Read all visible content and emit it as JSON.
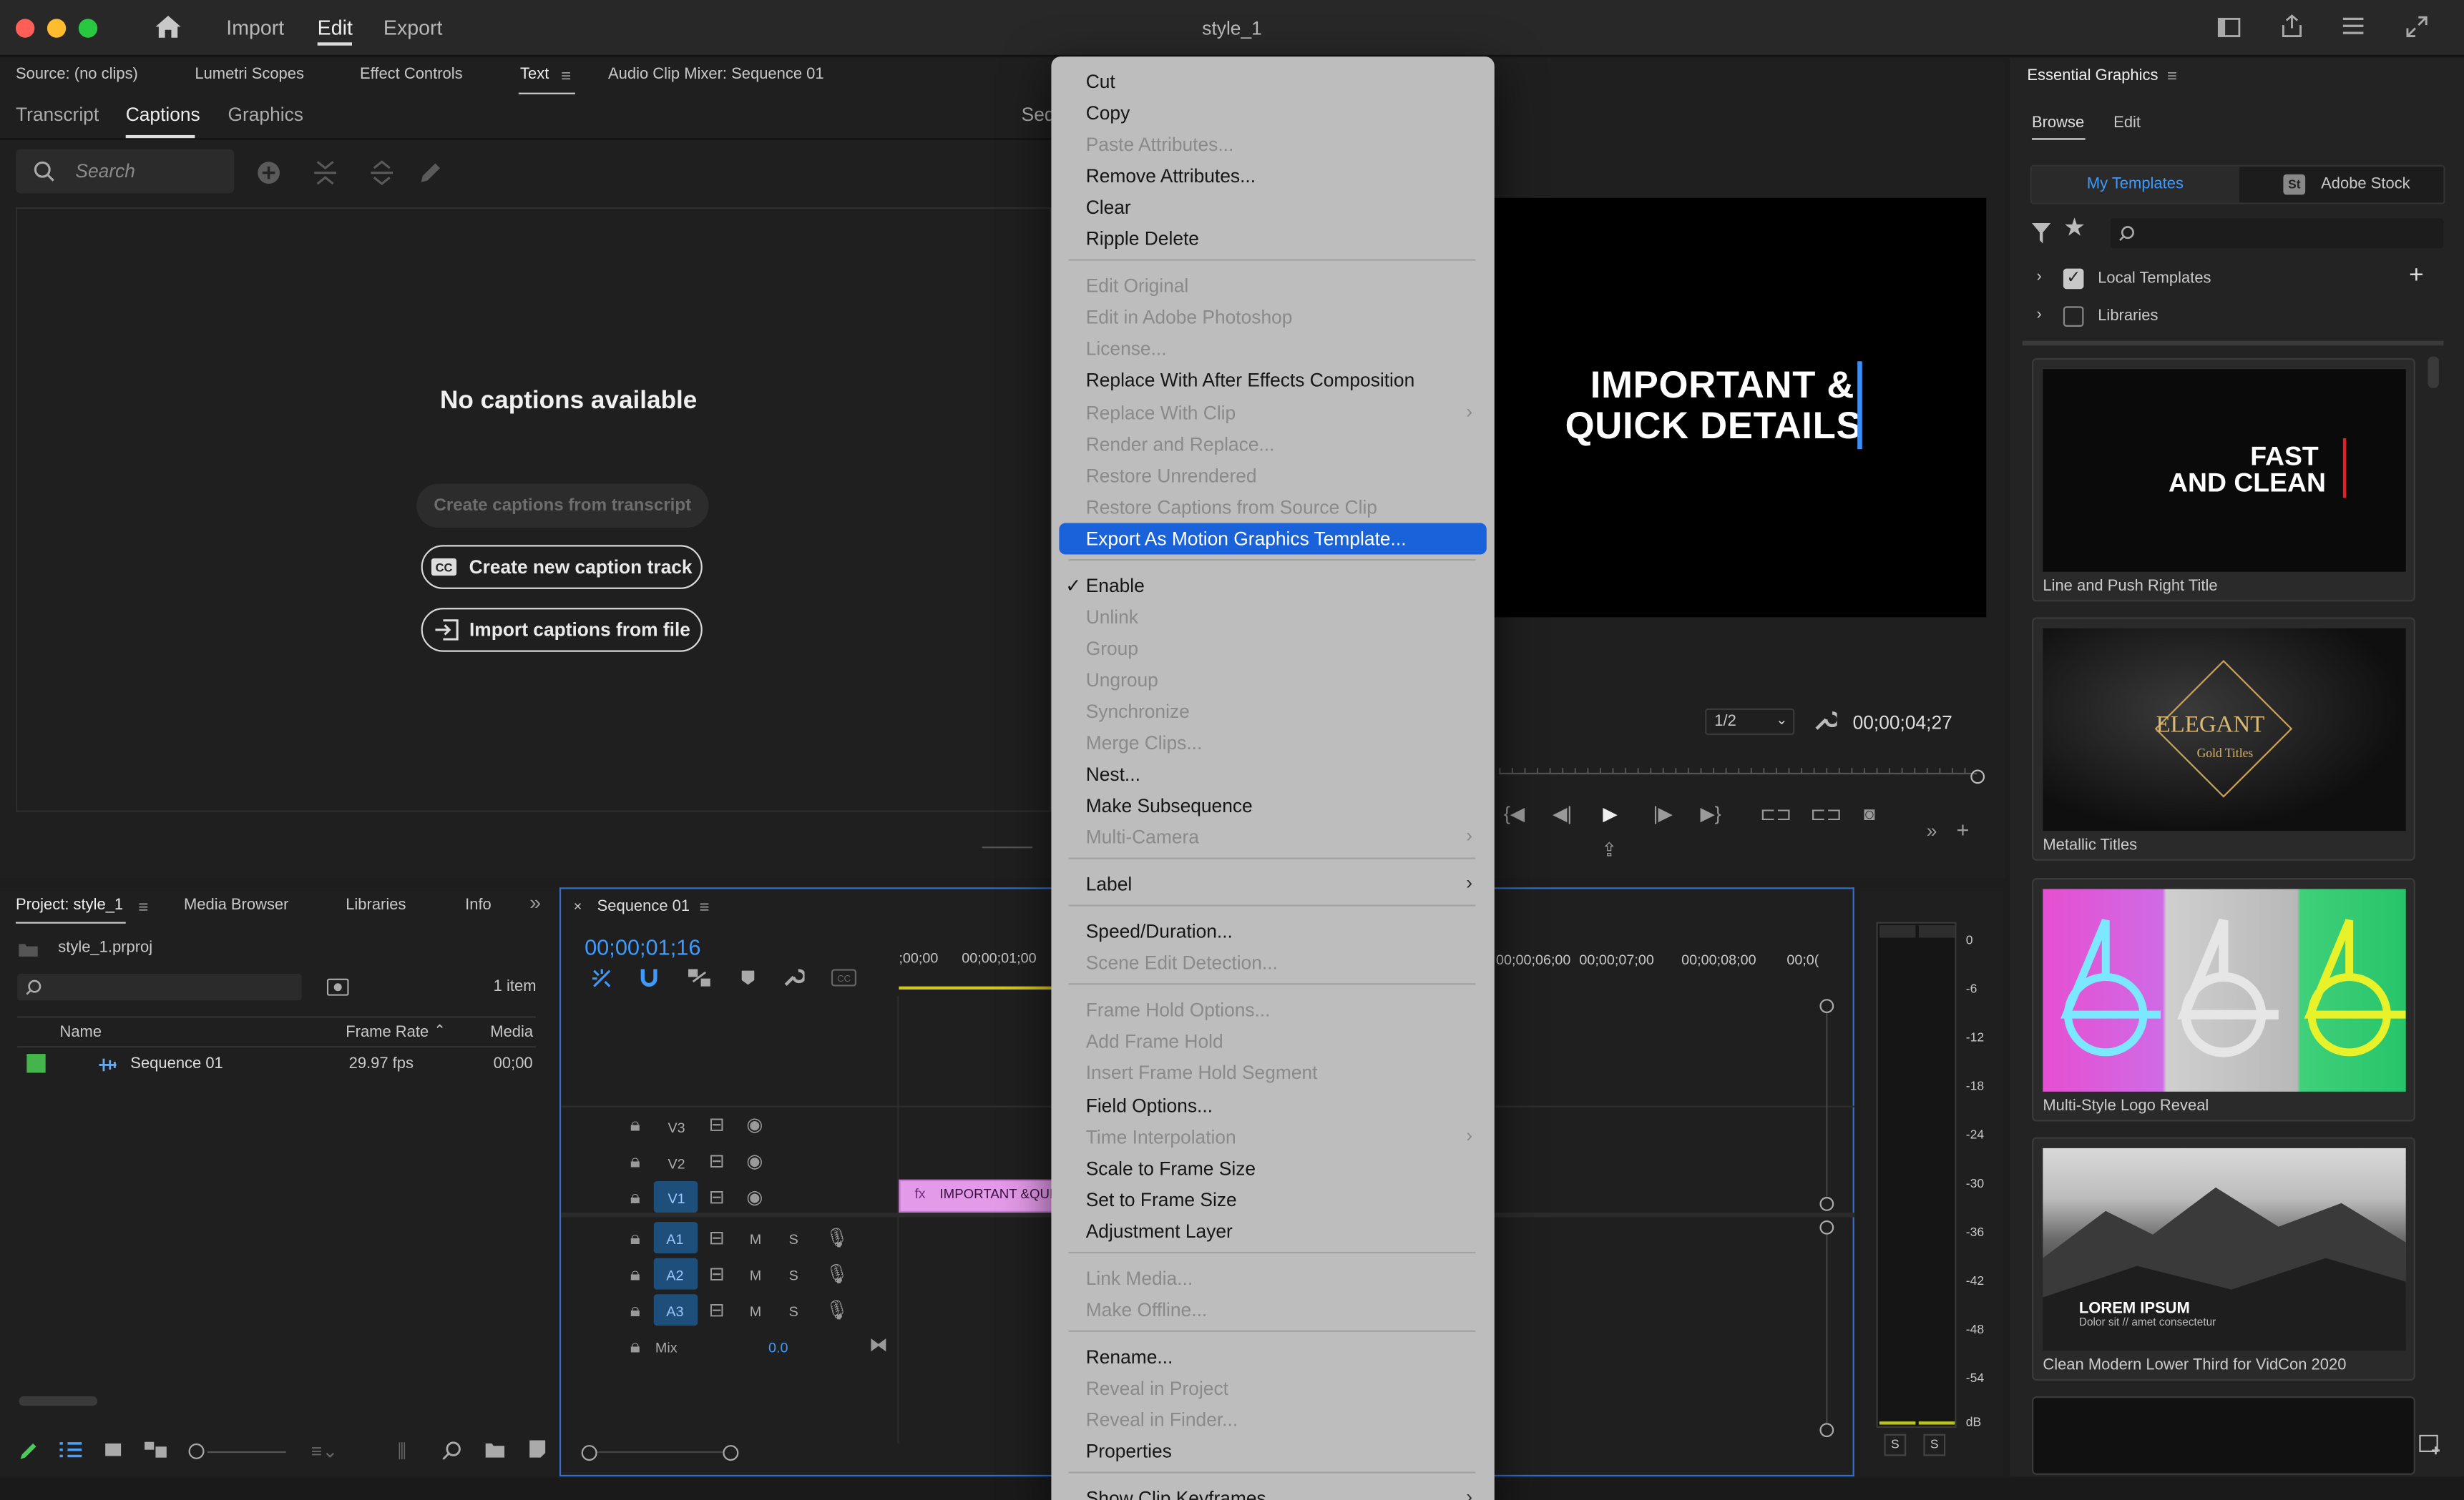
{
  "app": {
    "title": "style_1",
    "nav": [
      "Import",
      "Edit",
      "Export"
    ],
    "nav_active": "Edit"
  },
  "source_panel": {
    "tabs": [
      "Source: (no clips)",
      "Lumetri Scopes",
      "Effect Controls",
      "Text",
      "Audio Clip Mixer: Sequence 01"
    ],
    "subtabs": [
      "Transcript",
      "Captions",
      "Graphics"
    ],
    "active_subtab": "Captions",
    "search_placeholder": "Search",
    "empty_title": "No captions available",
    "btn_transcript": "Create captions from transcript",
    "btn_new_track": "Create new caption track",
    "btn_import": "Import captions from file",
    "program_tab_partial": "Seq"
  },
  "program_monitor": {
    "title_line1": "IMPORTANT &",
    "title_line2": "QUICK DETAILS",
    "resolution": "1/2",
    "timecode": "00;00;04;27"
  },
  "context_menu": {
    "items": [
      {
        "label": "Cut",
        "enabled": true
      },
      {
        "label": "Copy",
        "enabled": true
      },
      {
        "label": "Paste Attributes...",
        "enabled": false
      },
      {
        "label": "Remove Attributes...",
        "enabled": true
      },
      {
        "label": "Clear",
        "enabled": true
      },
      {
        "label": "Ripple Delete",
        "enabled": true
      },
      {
        "label": "Edit Original",
        "enabled": false
      },
      {
        "label": "Edit in Adobe Photoshop",
        "enabled": false
      },
      {
        "label": "License...",
        "enabled": false
      },
      {
        "label": "Replace With After Effects Composition",
        "enabled": true
      },
      {
        "label": "Replace With Clip",
        "enabled": false
      },
      {
        "label": "Render and Replace...",
        "enabled": false
      },
      {
        "label": "Restore Unrendered",
        "enabled": false
      },
      {
        "label": "Restore Captions from Source Clip",
        "enabled": false
      },
      {
        "label": "Export As Motion Graphics Template...",
        "enabled": true,
        "highlighted": true
      },
      {
        "label": "Enable",
        "enabled": true,
        "checked": true
      },
      {
        "label": "Unlink",
        "enabled": false
      },
      {
        "label": "Group",
        "enabled": false
      },
      {
        "label": "Ungroup",
        "enabled": false
      },
      {
        "label": "Synchronize",
        "enabled": false
      },
      {
        "label": "Merge Clips...",
        "enabled": false
      },
      {
        "label": "Nest...",
        "enabled": true
      },
      {
        "label": "Make Subsequence",
        "enabled": true
      },
      {
        "label": "Multi-Camera",
        "enabled": false
      },
      {
        "label": "Label",
        "enabled": true
      },
      {
        "label": "Speed/Duration...",
        "enabled": true
      },
      {
        "label": "Scene Edit Detection...",
        "enabled": false
      },
      {
        "label": "Frame Hold Options...",
        "enabled": false
      },
      {
        "label": "Add Frame Hold",
        "enabled": false
      },
      {
        "label": "Insert Frame Hold Segment",
        "enabled": false
      },
      {
        "label": "Field Options...",
        "enabled": true
      },
      {
        "label": "Time Interpolation",
        "enabled": false
      },
      {
        "label": "Scale to Frame Size",
        "enabled": true
      },
      {
        "label": "Set to Frame Size",
        "enabled": true
      },
      {
        "label": "Adjustment Layer",
        "enabled": true
      },
      {
        "label": "Link Media...",
        "enabled": false
      },
      {
        "label": "Make Offline...",
        "enabled": false
      },
      {
        "label": "Rename...",
        "enabled": true
      },
      {
        "label": "Reveal in Project",
        "enabled": false
      },
      {
        "label": "Reveal in Finder...",
        "enabled": false
      },
      {
        "label": "Properties",
        "enabled": true
      },
      {
        "label": "Show Clip Keyframes",
        "enabled": true
      }
    ]
  },
  "project_panel": {
    "tabs": [
      "Project: style_1",
      "Media Browser",
      "Libraries",
      "Info"
    ],
    "file": "style_1.prproj",
    "item_count": "1 item",
    "columns": [
      "Name",
      "Frame Rate",
      "Media"
    ],
    "rows": [
      {
        "name": "Sequence 01",
        "frame_rate": "29.97 fps",
        "media": "00;00"
      }
    ]
  },
  "timeline": {
    "tab": "Sequence 01",
    "timecode": "00;00;01;16",
    "ruler_left": [
      ";00;00",
      "00;00;01;00"
    ],
    "ruler_right": [
      "00;00;06;00",
      "00;00;07;00",
      "00;00;08;00",
      "00;0("
    ],
    "video_tracks": [
      "V3",
      "V2",
      "V1"
    ],
    "audio_tracks": [
      "A1",
      "A2",
      "A3"
    ],
    "mix_label": "Mix",
    "mix_value": "0.0",
    "clip_label": "IMPORTANT &QUIC",
    "m": "M",
    "s": "S"
  },
  "audio_meter": {
    "scale": [
      "0",
      "-6",
      "-12",
      "-18",
      "-24",
      "-30",
      "-36",
      "-42",
      "-48",
      "-54",
      "dB"
    ],
    "solo": "S"
  },
  "essential_graphics": {
    "title": "Essential Graphics",
    "tabs": [
      "Browse",
      "Edit"
    ],
    "source_tabs": [
      "My Templates",
      "Adobe Stock"
    ],
    "stock_badge": "St",
    "folders": [
      {
        "label": "Local Templates",
        "checked": true
      },
      {
        "label": "Libraries",
        "checked": false
      }
    ],
    "templates": [
      {
        "name": "Line and Push Right Title",
        "thumb_line1": "FAST",
        "thumb_line2": "AND CLEAN"
      },
      {
        "name": "Metallic Titles",
        "thumb_line1": "ELEGANT",
        "thumb_line2": "Gold Titles"
      },
      {
        "name": "Multi-Style Logo Reveal",
        "thumb_line1": "",
        "thumb_line2": ""
      },
      {
        "name": "Clean Modern Lower Third for VidCon 2020",
        "thumb_line1": "LOREM IPSUM",
        "thumb_line2": "Dolor sit // amet consectetur"
      }
    ]
  },
  "colors": {
    "accent": "#1a62d9",
    "timecode": "#3d9bff",
    "clip": "#e39ae8"
  }
}
